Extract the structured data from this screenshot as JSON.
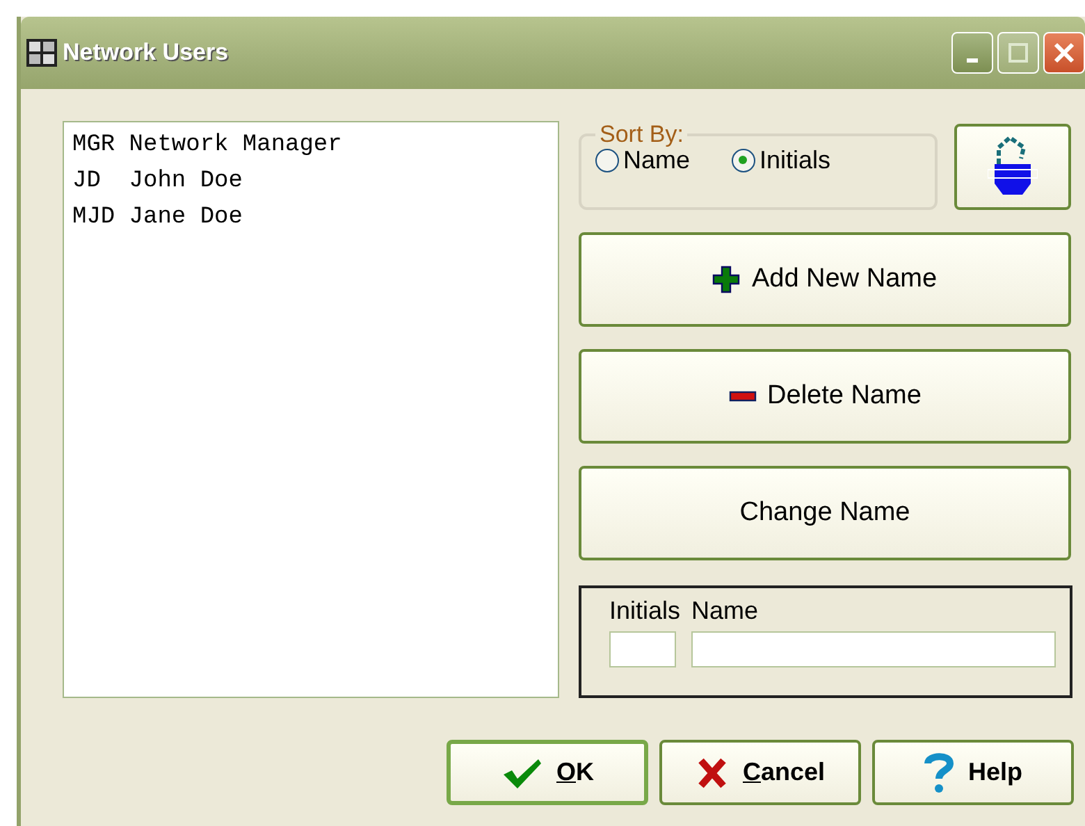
{
  "window": {
    "title": "Network Users"
  },
  "users": [
    "MGR Network Manager",
    "JD  John Doe",
    "MJD Jane Doe"
  ],
  "sort_by": {
    "label": "Sort By:",
    "options": [
      {
        "label": "Name",
        "selected": false
      },
      {
        "label": "Initials",
        "selected": true
      }
    ]
  },
  "actions": [
    {
      "kind": "add",
      "label": "Add New Name"
    },
    {
      "kind": "delete",
      "label": "Delete Name"
    },
    {
      "kind": "change",
      "label": "Change Name"
    }
  ],
  "entry": {
    "initials_label": "Initials",
    "name_label": "Name"
  },
  "buttons": [
    {
      "kind": "ok",
      "label": "OK",
      "underline_first": true,
      "focused": true
    },
    {
      "kind": "cancel",
      "label": "Cancel",
      "underline_first": true,
      "focused": false
    },
    {
      "kind": "help",
      "label": "Help",
      "underline_first": false,
      "focused": false
    }
  ]
}
